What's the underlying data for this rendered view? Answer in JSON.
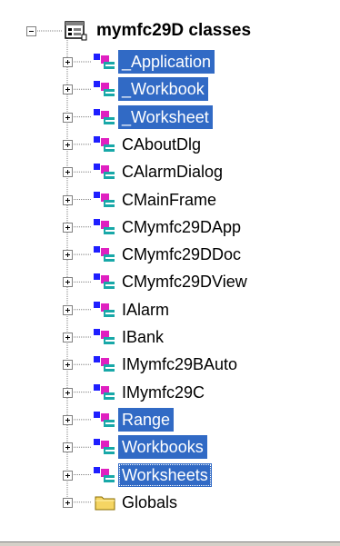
{
  "tree": {
    "root": {
      "label": "mymfc29D classes",
      "icon": "classes-root-icon",
      "expanded": true
    },
    "items": [
      {
        "label": "_Application",
        "icon": "class-icon",
        "selected": true
      },
      {
        "label": "_Workbook",
        "icon": "class-icon",
        "selected": true
      },
      {
        "label": "_Worksheet",
        "icon": "class-icon",
        "selected": true
      },
      {
        "label": "CAboutDlg",
        "icon": "class-icon",
        "selected": false
      },
      {
        "label": "CAlarmDialog",
        "icon": "class-icon",
        "selected": false
      },
      {
        "label": "CMainFrame",
        "icon": "class-icon",
        "selected": false
      },
      {
        "label": "CMymfc29DApp",
        "icon": "class-icon",
        "selected": false
      },
      {
        "label": "CMymfc29DDoc",
        "icon": "class-icon",
        "selected": false
      },
      {
        "label": "CMymfc29DView",
        "icon": "class-icon",
        "selected": false
      },
      {
        "label": "IAlarm",
        "icon": "class-icon",
        "selected": false
      },
      {
        "label": "IBank",
        "icon": "class-icon",
        "selected": false
      },
      {
        "label": "IMymfc29BAuto",
        "icon": "class-icon",
        "selected": false
      },
      {
        "label": "IMymfc29C",
        "icon": "class-icon",
        "selected": false
      },
      {
        "label": "Range",
        "icon": "class-icon",
        "selected": true
      },
      {
        "label": "Workbooks",
        "icon": "class-icon",
        "selected": true
      },
      {
        "label": "Worksheets",
        "icon": "class-icon",
        "selected": true,
        "focused": true
      },
      {
        "label": "Globals",
        "icon": "folder-icon",
        "selected": false
      }
    ],
    "colors": {
      "selection": "#316ac5",
      "selection_text": "#ffffff",
      "folder": "#f5d563"
    }
  }
}
